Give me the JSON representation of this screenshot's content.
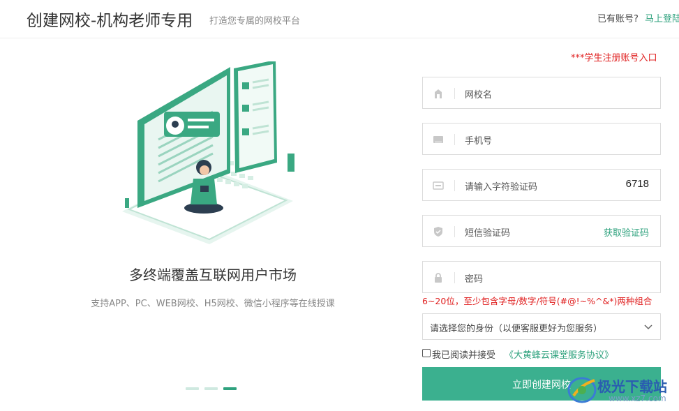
{
  "header": {
    "title": "创建网校-机构老师专用",
    "subtitle": "打造您专属的网校平台",
    "have_account": "已有账号?",
    "login_link": "马上登陆"
  },
  "promo": {
    "title": "多终端覆盖互联网用户市场",
    "subtitle": "支持APP、PC、WEB网校、H5网校、微信小程序等在线授课",
    "carousel": {
      "count": 3,
      "active_index": 2
    }
  },
  "form": {
    "student_link": "***学生注册账号入口",
    "school_name": {
      "placeholder": "网校名",
      "icon": "building-icon"
    },
    "phone": {
      "placeholder": "手机号",
      "icon": "phone-icon"
    },
    "captcha": {
      "placeholder": "请输入字符验证码",
      "code": "6718",
      "icon": "captcha-icon"
    },
    "sms": {
      "placeholder": "短信验证码",
      "action": "获取验证码",
      "icon": "shield-icon"
    },
    "password": {
      "placeholder": "密码",
      "icon": "lock-icon"
    },
    "password_hint": "6~20位，至少包含字母/数字/符号(#@!~%^&*)两种组合",
    "role_select": {
      "value": "请选择您的身份（以便客服更好为您服务）",
      "icon": "chevron-down-icon"
    },
    "agreement": {
      "text": "我已阅读并接受",
      "link": "《大黄蜂云课堂服务协议》",
      "checked": false
    },
    "submit": "立即创建网校"
  },
  "watermark": {
    "text": "极光下载站",
    "url": "www.xz7.com"
  },
  "colors": {
    "accent": "#3bb08f",
    "link": "#2fa27e",
    "error": "#e02020"
  }
}
